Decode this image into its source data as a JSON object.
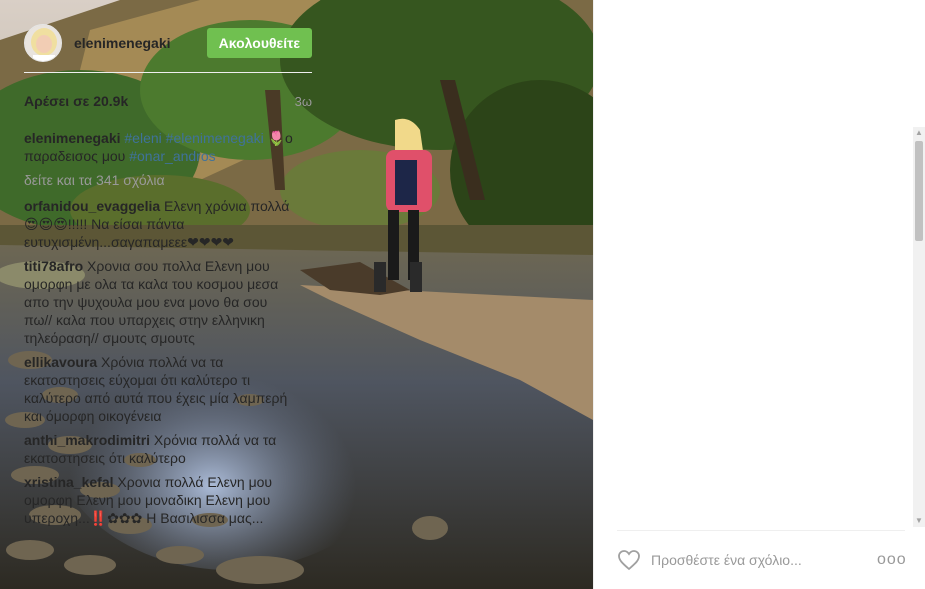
{
  "post": {
    "username": "elenimenegaki",
    "follow_label": "Ακολουθείτε",
    "likes": "Αρέσει σε 20.9k",
    "time": "3ω"
  },
  "caption": {
    "user": "elenimenegaki",
    "tag1": "#eleni",
    "tag2": "#elenimenegaki",
    "text": "🌷ο παραδεισος μου",
    "tag3": "#onar_andros"
  },
  "load_more": "δείτε και τα 341 σχόλια",
  "comments": [
    {
      "user": "orfanidou_evaggelia",
      "text": "Ελενη χρόνια πολλά😍😍😍!!!!! Να είσαι πάντα ευτυχισμένη...σαγαπαμεεε❤❤❤❤"
    },
    {
      "user": "titi78afro",
      "text": "Χρονια σου πολλα Ελενη μου ομορφη με ολα τα καλα του κοσμου μεσα απο την ψυχουλα μου ενα μονο θα σου πω// καλα που υπαρχεις στην ελληνικη τηλεόραση// σμουτς σμουτς"
    },
    {
      "user": "ellikavoura",
      "text": "Χρόνια πολλά να τα εκατοστησεις εύχομαι ότι καλύτερο τι καλύτερο από αυτά που έχεις μία λαμπερή και όμορφη οικογένεια"
    },
    {
      "user": "anthi_makrodimitri",
      "text": "Χρόνια πολλά να τα εκατοστησεις ότι καλύτερο"
    },
    {
      "user": "xristina_kefal",
      "text": "Χρονια πολλά Ελενη μου ομορφη Ελενη μου μοναδικη Ελενη μου υπεροχη...‼️✿✿✿ Η Βασιλισσα μας..."
    }
  ],
  "comment_box": {
    "placeholder": "Προσθέστε ένα σχόλιο..."
  },
  "more_label": "ooo",
  "icons": {
    "heart": "heart-outline-icon",
    "more": "more-options-icon"
  },
  "colors": {
    "follow_button": "#70c050",
    "hashtag": "#3f729b",
    "muted": "#999999"
  }
}
